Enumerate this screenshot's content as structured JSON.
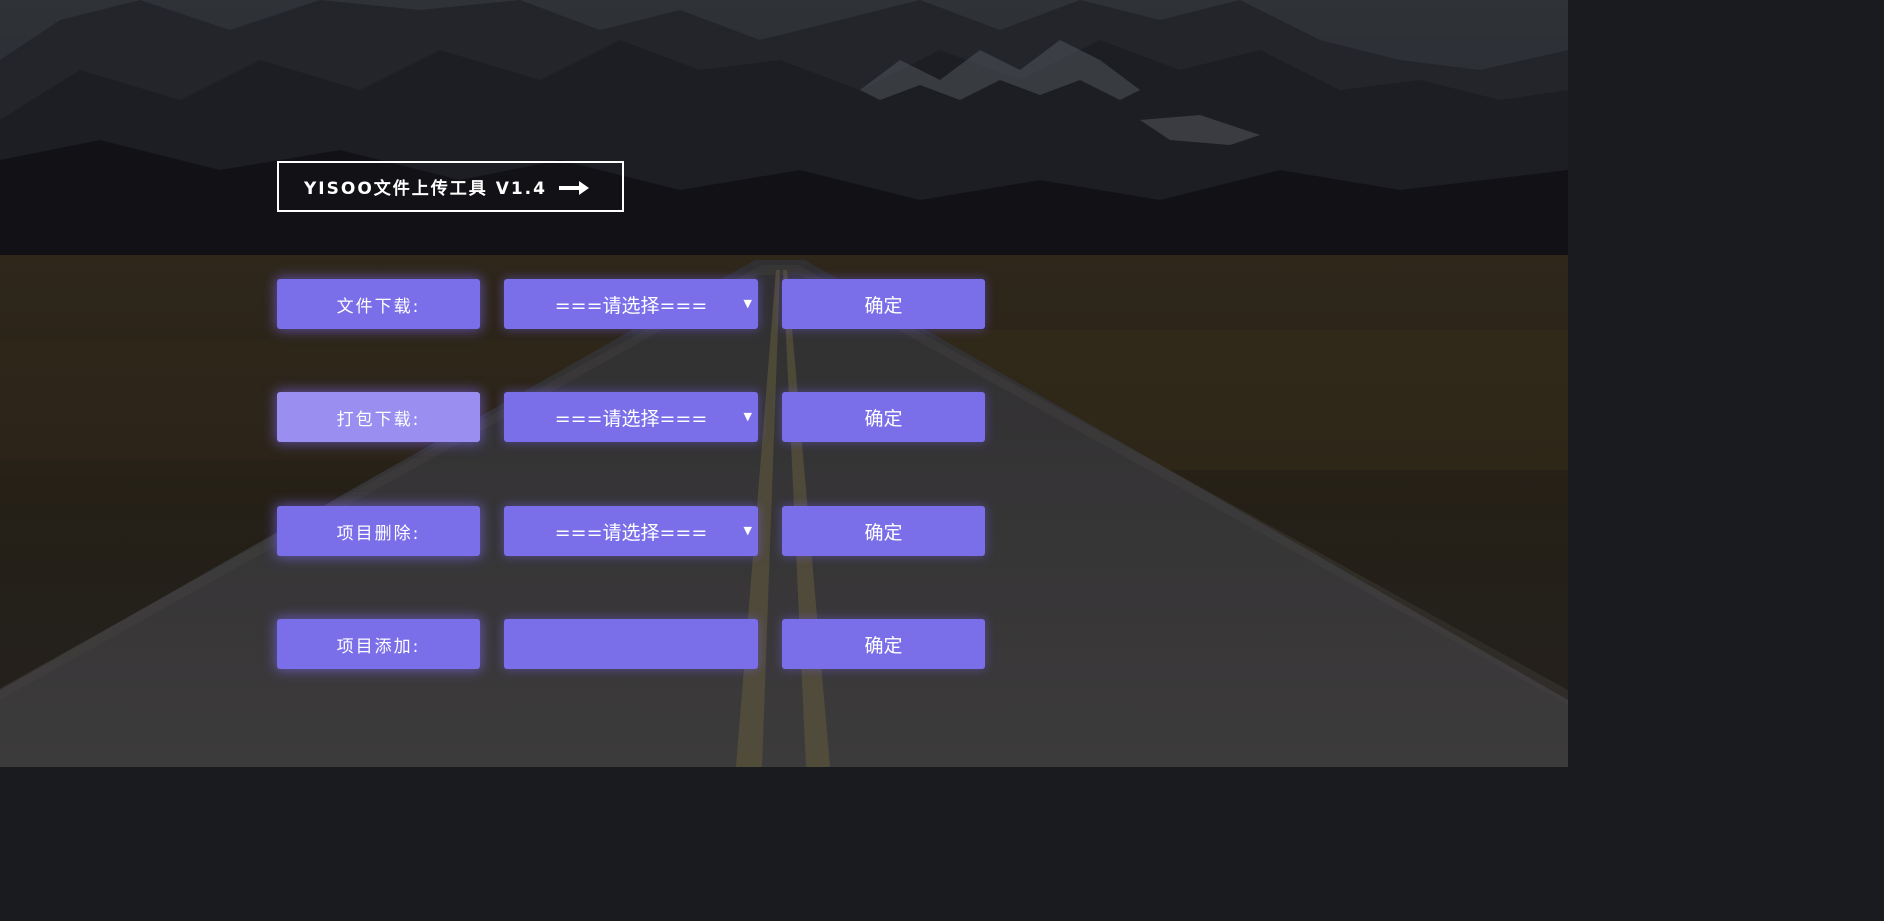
{
  "colors": {
    "accent": "#7a6fe8",
    "accent_hover": "#9a8ff0",
    "text": "#ffffff"
  },
  "header": {
    "title": "YISOO文件上传工具 V1.4",
    "arrow_icon": "arrow-right-icon"
  },
  "rows": [
    {
      "label": "文件下载:",
      "select_value": "===请选择===",
      "confirm_label": "确定"
    },
    {
      "label": "打包下载:",
      "select_value": "===请选择===",
      "confirm_label": "确定"
    },
    {
      "label": "项目删除:",
      "select_value": "===请选择===",
      "confirm_label": "确定"
    },
    {
      "label": "项目添加:",
      "input_value": "",
      "confirm_label": "确定"
    }
  ],
  "icons": {
    "dropdown_caret": "chevron-down-icon"
  }
}
